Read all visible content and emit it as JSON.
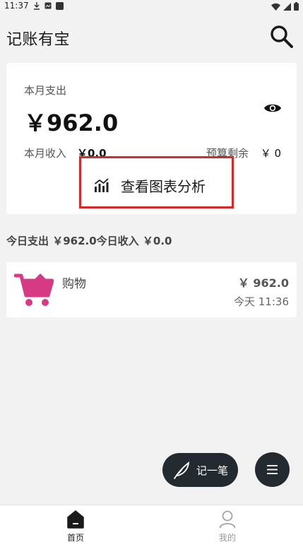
{
  "status_bar": {
    "time": "11:37",
    "left_icons": [
      "download-icon",
      "image-icon",
      "app-icon"
    ],
    "right_icons": [
      "wifi-icon",
      "signal-icon",
      "battery-icon"
    ]
  },
  "header": {
    "title": "记账有宝",
    "search_icon": "search-icon"
  },
  "summary": {
    "month_label": "本月支出",
    "month_amount": "￥962.0",
    "income_label": "本月收入",
    "income_value": "￥0.0",
    "budget_label": "预算剩余",
    "budget_value": "￥ 0",
    "chart_button_label": "查看图表分析",
    "highlight_color": "#d62929"
  },
  "daily": {
    "text": "今日支出 ￥962.0今日收入 ￥0.0"
  },
  "transactions": [
    {
      "icon": "shopping-cart-icon",
      "icon_color": "#d63a84",
      "category": "购物",
      "amount": "￥ 962.0",
      "time": "今天 11:36"
    }
  ],
  "fab": {
    "record_label": "记一笔",
    "record_icon": "feather-icon",
    "menu_icon": "menu-icon",
    "color": "#232a30"
  },
  "bottom_nav": {
    "items": [
      {
        "label": "首页",
        "icon": "home-icon",
        "active": true
      },
      {
        "label": "我的",
        "icon": "user-icon",
        "active": false
      }
    ]
  }
}
